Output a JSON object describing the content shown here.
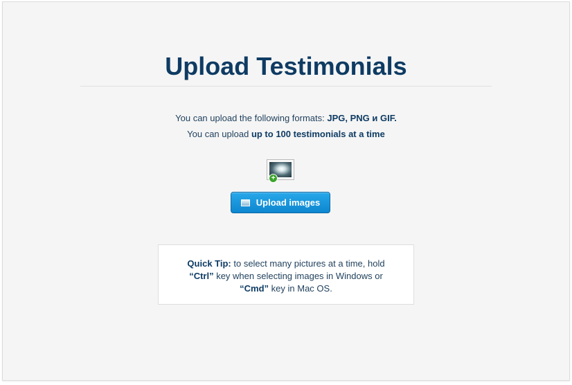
{
  "page": {
    "title": "Upload Testimonials"
  },
  "info": {
    "formats_prefix": "You can upload the following formats: ",
    "formats_value": "JPG, PNG и GIF.",
    "limit_prefix": "You can upload ",
    "limit_value": "up to 100 testimonials at a time"
  },
  "upload": {
    "button_label": "Upload images",
    "button_icon": "image-icon",
    "preview_icon": "add-image-icon"
  },
  "tip": {
    "label": "Quick Tip:",
    "text_1": " to select many pictures at a time, hold",
    "key_1": "“Ctrl”",
    "text_2": " key when selecting images in Windows or",
    "key_2": "“Cmd”",
    "text_3": " key in Mac OS."
  },
  "colors": {
    "title": "#0e3b63",
    "button_top": "#28a8ea",
    "button_bottom": "#0d86cf",
    "panel_bg": "#f5f5f5"
  }
}
